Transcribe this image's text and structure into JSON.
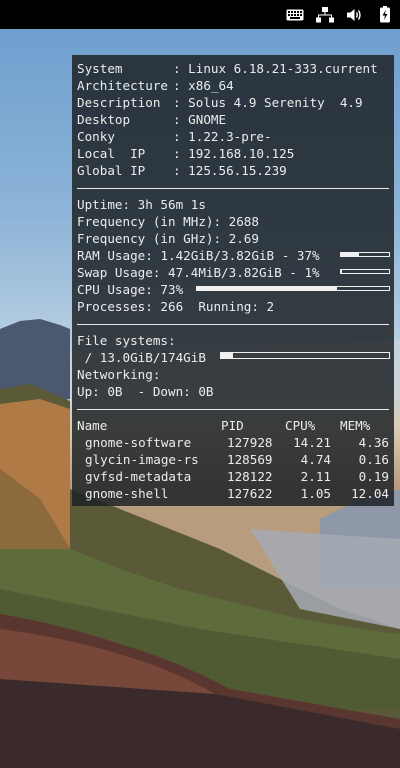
{
  "topbar": {
    "icons": [
      "keyboard-icon",
      "network-icon",
      "volume-icon",
      "battery-icon"
    ]
  },
  "system": {
    "rows": [
      {
        "label": "System",
        "value": "Linux 6.18.21-333.current"
      },
      {
        "label": "Architecture",
        "value": "x86_64"
      },
      {
        "label": "Description",
        "value": "Solus 4.9 Serenity  4.9"
      },
      {
        "label": "Desktop",
        "value": "GNOME"
      },
      {
        "label": "Conky",
        "value": "1.22.3-pre-"
      },
      {
        "label": "Local  IP",
        "value": "192.168.10.125"
      },
      {
        "label": "Global IP",
        "value": "125.56.15.239"
      }
    ]
  },
  "stats": {
    "uptime": "Uptime: 3h 56m 1s",
    "freq_mhz": "Frequency (in MHz): 2688",
    "freq_ghz": "Frequency (in GHz): 2.69",
    "ram": "RAM Usage: 1.42GiB/3.82GiB - 37%",
    "ram_percent": 37,
    "swap": "Swap Usage: 47.4MiB/3.82GiB - 1%",
    "swap_percent": 1,
    "cpu": "CPU Usage: 73%",
    "cpu_percent": 73,
    "processes": "Processes: 266  Running: 2"
  },
  "fs": {
    "title": "File systems:",
    "root": " / 13.0GiB/174GiB",
    "root_percent": 7,
    "networking": "Networking:",
    "updown": "Up: 0B  - Down: 0B"
  },
  "procs": {
    "headers": {
      "name": "Name",
      "pid": "PID",
      "cpu": "CPU%",
      "mem": "MEM%"
    },
    "rows": [
      {
        "name": "gnome-software",
        "pid": "127928",
        "cpu": "14.21",
        "mem": "4.36"
      },
      {
        "name": "glycin-image-rs",
        "pid": "128569",
        "cpu": "4.74",
        "mem": "0.16"
      },
      {
        "name": "gvfsd-metadata",
        "pid": "128122",
        "cpu": "2.11",
        "mem": "0.19"
      },
      {
        "name": "gnome-shell",
        "pid": "127622",
        "cpu": "1.05",
        "mem": "12.04"
      }
    ]
  }
}
